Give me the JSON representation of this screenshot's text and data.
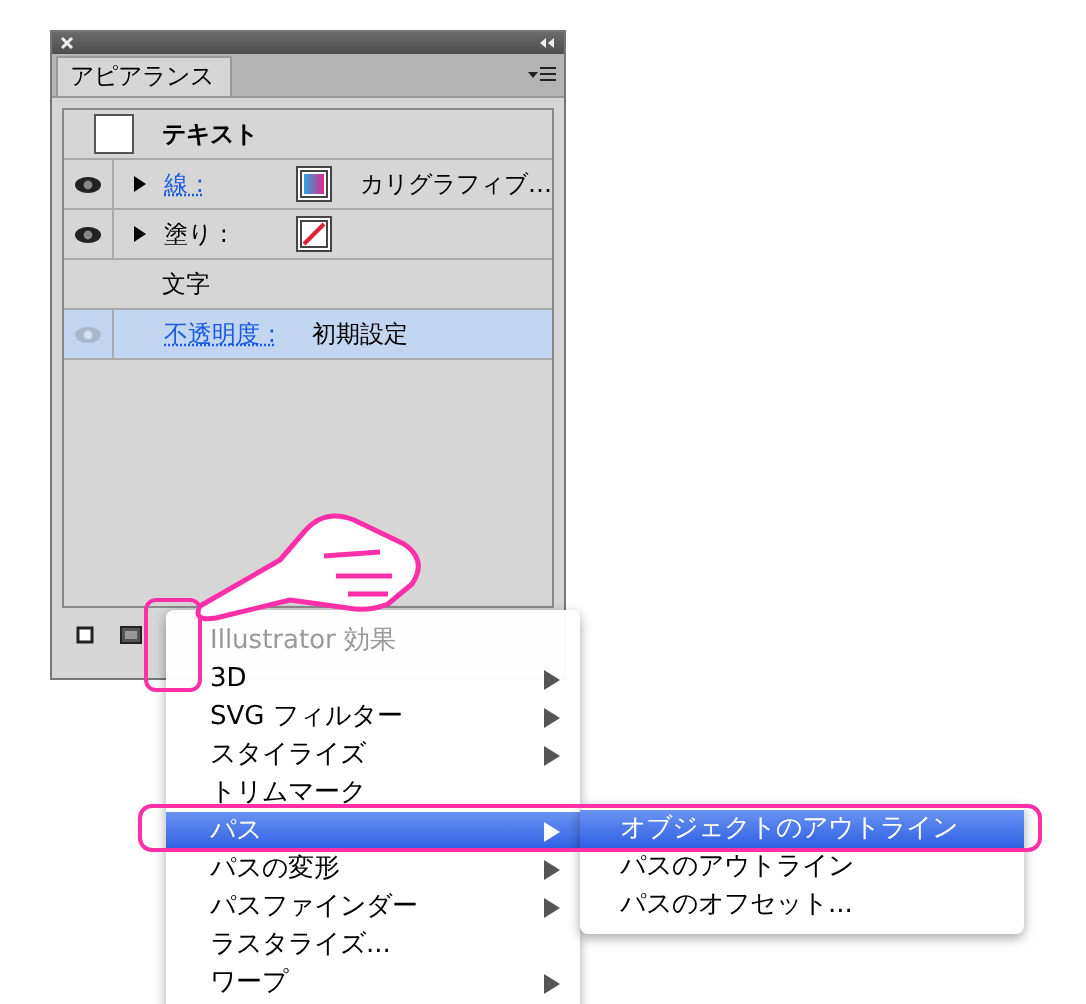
{
  "panel": {
    "tab": "アピアランス",
    "rows": [
      {
        "kind": "object",
        "label": "テキスト"
      },
      {
        "kind": "attribute",
        "eye": true,
        "expandable": true,
        "label": "線 :",
        "link": true,
        "swatch": {
          "kind": "gradient"
        },
        "value": "カリグラフィブ…"
      },
      {
        "kind": "attribute",
        "eye": true,
        "expandable": true,
        "label": "塗り :",
        "link": false,
        "swatch": {
          "kind": "none"
        }
      },
      {
        "kind": "group",
        "label": "文字"
      },
      {
        "kind": "attribute",
        "eye": false,
        "expandable": false,
        "label": "不透明度 :",
        "link": true,
        "selected": true,
        "value": "初期設定"
      }
    ]
  },
  "menu": {
    "items": [
      {
        "label": "Illustrator 効果",
        "disabled": true,
        "submenu": false,
        "selected": false
      },
      {
        "label": "3D",
        "disabled": false,
        "submenu": true,
        "selected": false
      },
      {
        "label": "SVG フィルター",
        "disabled": false,
        "submenu": true,
        "selected": false
      },
      {
        "label": "スタイライズ",
        "disabled": false,
        "submenu": true,
        "selected": false
      },
      {
        "label": "トリムマーク",
        "disabled": false,
        "submenu": false,
        "selected": false
      },
      {
        "label": "パス",
        "disabled": false,
        "submenu": true,
        "selected": true
      },
      {
        "label": "パスの変形",
        "disabled": false,
        "submenu": true,
        "selected": false
      },
      {
        "label": "パスファインダー",
        "disabled": false,
        "submenu": true,
        "selected": false
      },
      {
        "label": "ラスタライズ...",
        "disabled": false,
        "submenu": false,
        "selected": false
      },
      {
        "label": "ワープ",
        "disabled": false,
        "submenu": true,
        "selected": false
      }
    ]
  },
  "submenu": {
    "items": [
      {
        "label": "オブジェクトのアウトライン",
        "selected": true
      },
      {
        "label": "パスのアウトライン",
        "selected": false
      },
      {
        "label": "パスのオフセット...",
        "selected": false
      }
    ]
  }
}
